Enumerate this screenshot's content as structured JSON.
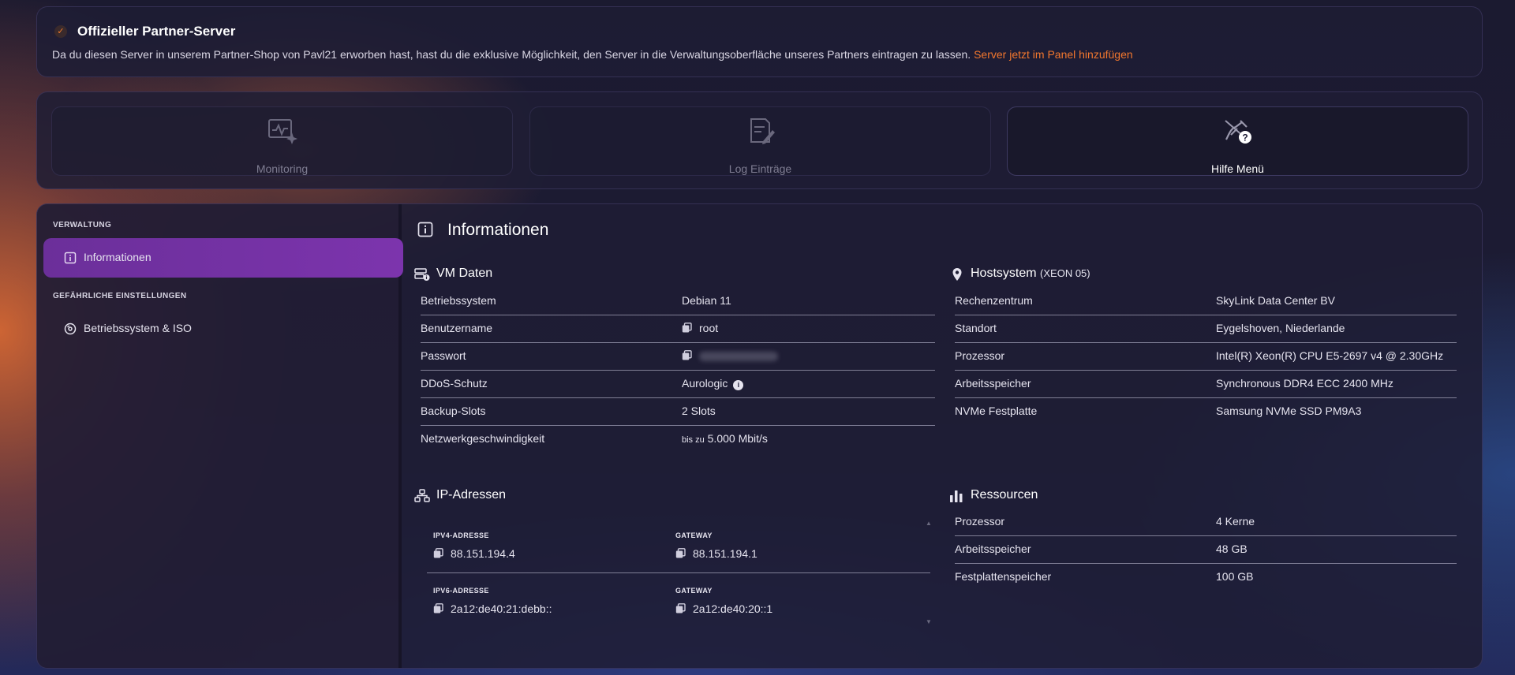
{
  "partner_banner": {
    "check_glyph": "✓",
    "title": "Offizieller Partner-Server",
    "text": "Da du diesen Server in unserem Partner-Shop von Pavl21 erworben hast, hast du die exklusive Möglichkeit, den Server in die Verwaltungsoberfläche unseres Partners eintragen zu lassen.",
    "link": "Server jetzt im Panel hinzufügen",
    "link_color": "#f2772e"
  },
  "tabs": [
    {
      "label": "Monitoring",
      "icon": "monitoring-icon",
      "active": false
    },
    {
      "label": "Log Einträge",
      "icon": "log-edit-icon",
      "active": false
    },
    {
      "label": "Hilfe Menü",
      "icon": "help-icon",
      "active": true
    }
  ],
  "sidebar": {
    "section1": "VERWALTUNG",
    "section2": "GEFÄHRLICHE EINSTELLUNGEN",
    "items": [
      {
        "label": "Informationen",
        "icon": "info-icon",
        "active": true
      },
      {
        "label": "Betriebssystem & ISO",
        "icon": "os-disc-icon",
        "active": false
      }
    ],
    "accent": "#7c34ad"
  },
  "main": {
    "title": "Informationen",
    "vm": {
      "title": "VM Daten",
      "rows": [
        {
          "key": "Betriebssystem",
          "value": "Debian 11"
        },
        {
          "key": "Benutzername",
          "value": "root"
        },
        {
          "key": "Passwort",
          "value": ""
        },
        {
          "key": "DDoS-Schutz",
          "value": "Aurologic"
        },
        {
          "key": "Backup-Slots",
          "value": "2 Slots"
        },
        {
          "key": "Netzwerkgeschwindigkeit",
          "prefix": "bis zu",
          "value": "5.000 Mbit/s"
        }
      ]
    },
    "host": {
      "title": "Hostsystem",
      "subtitle": "(XEON 05)",
      "rows": [
        {
          "key": "Rechenzentrum",
          "value": "SkyLink Data Center BV"
        },
        {
          "key": "Standort",
          "value": "Eygelshoven, Niederlande"
        },
        {
          "key": "Prozessor",
          "value": "Intel(R) Xeon(R) CPU E5-2697 v4 @ 2.30GHz"
        },
        {
          "key": "Arbeitsspeicher",
          "value": "Synchronous DDR4 ECC 2400 MHz"
        },
        {
          "key": "NVMe Festplatte",
          "value": "Samsung NVMe SSD PM9A3"
        }
      ]
    },
    "ip": {
      "title": "IP-Adressen",
      "v4_label": "IPV4-ADRESSE",
      "v4_value": "88.151.194.4",
      "v4_gateway_label": "GATEWAY",
      "v4_gateway_value": "88.151.194.1",
      "v6_label": "IPV6-ADRESSE",
      "v6_value": "2a12:de40:21:debb::",
      "v6_gateway_label": "GATEWAY",
      "v6_gateway_value": "2a12:de40:20::1"
    },
    "resources": {
      "title": "Ressourcen",
      "rows": [
        {
          "key": "Prozessor",
          "value": "4 Kerne"
        },
        {
          "key": "Arbeitsspeicher",
          "value": "48 GB"
        },
        {
          "key": "Festplattenspeicher",
          "value": "100 GB"
        }
      ]
    }
  }
}
